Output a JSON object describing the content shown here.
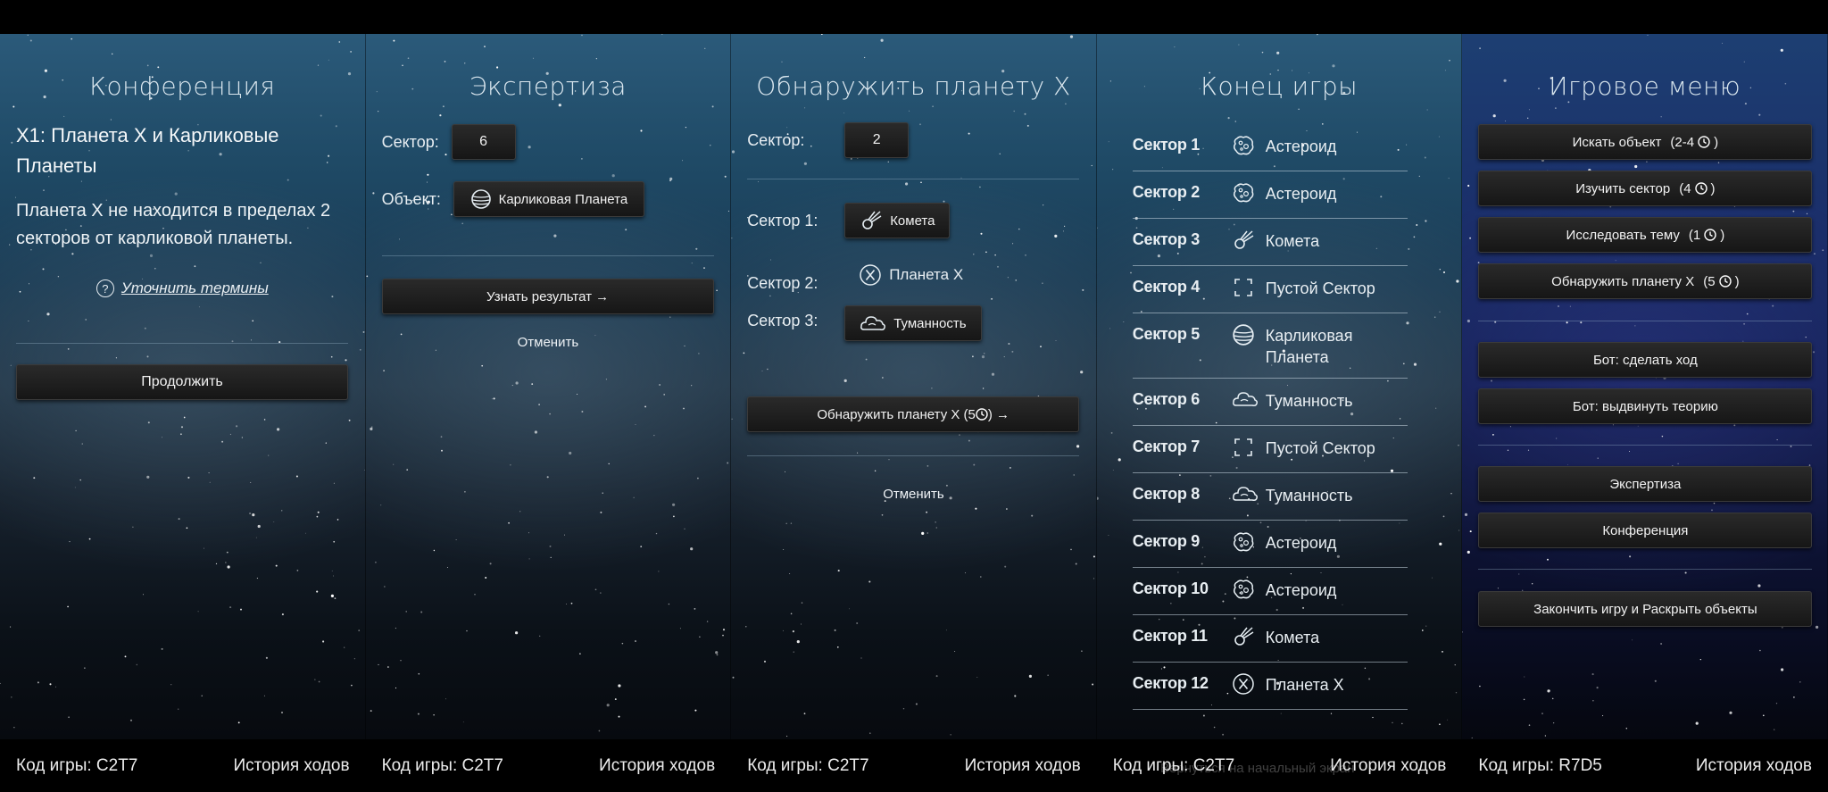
{
  "screen1": {
    "title": "Конференция",
    "heading": "X1: Планета X и Карликовые Планеты",
    "body": "Планета X не находится в пределах 2 секторов от карликовой планеты.",
    "terms_link": "Уточнить термины",
    "continue_button": "Продолжить"
  },
  "screen2": {
    "title": "Экспертиза",
    "sector_label": "Сектор:",
    "sector_value": "6",
    "object_label": "Объект:",
    "object_value": "Карликовая Планета",
    "object_icon": "dwarf-planet-icon",
    "result_button": "Узнать результат →",
    "cancel": "Отменить"
  },
  "screen3": {
    "title": "Обнаружить планету X",
    "sector_label": "Сектор:",
    "sector_value": "2",
    "sector1_label": "Сектор 1:",
    "sector1_value": "Комета",
    "sector2_label": "Сектор 2:",
    "sector2_value": "Планета X",
    "sector3_label": "Сектор 3:",
    "sector3_value": "Туманность",
    "detect_button_prefix": "Обнаружить планету X (5",
    "detect_button_suffix": ") →",
    "cancel": "Отменить"
  },
  "screen4": {
    "title": "Конец игры",
    "sectors": [
      {
        "name": "Сектор 1",
        "object": "Астероид",
        "icon": "asteroid-icon"
      },
      {
        "name": "Сектор 2",
        "object": "Астероид",
        "icon": "asteroid-icon"
      },
      {
        "name": "Сектор 3",
        "object": "Комета",
        "icon": "comet-icon"
      },
      {
        "name": "Сектор 4",
        "object": "Пустой Сектор",
        "icon": "empty-sector-icon"
      },
      {
        "name": "Сектор 5",
        "object": "Карликовая Планета",
        "icon": "dwarf-planet-icon"
      },
      {
        "name": "Сектор 6",
        "object": "Туманность",
        "icon": "nebula-icon"
      },
      {
        "name": "Сектор 7",
        "object": "Пустой Сектор",
        "icon": "empty-sector-icon"
      },
      {
        "name": "Сектор 8",
        "object": "Туманность",
        "icon": "nebula-icon"
      },
      {
        "name": "Сектор 9",
        "object": "Астероид",
        "icon": "asteroid-icon"
      },
      {
        "name": "Сектор 10",
        "object": "Астероид",
        "icon": "asteroid-icon"
      },
      {
        "name": "Сектор 11",
        "object": "Комета",
        "icon": "comet-icon"
      },
      {
        "name": "Сектор 12",
        "object": "Планета X",
        "icon": "planet-x-icon"
      }
    ],
    "ghost_text": "Вернуться на начальный экран"
  },
  "screen5": {
    "title": "Игровое меню",
    "search_object": {
      "label": "Искать объект",
      "cost_prefix": "(2-4",
      "cost_suffix": ")"
    },
    "survey_sector": {
      "label": "Изучить сектор",
      "cost_prefix": "(4",
      "cost_suffix": ")"
    },
    "research_topic": {
      "label": "Исследовать тему",
      "cost_prefix": "(1",
      "cost_suffix": ")"
    },
    "locate_planet": {
      "label": "Обнаружить планету X",
      "cost_prefix": "(5",
      "cost_suffix": ")"
    },
    "bot_move": "Бот: сделать ход",
    "bot_theory": "Бот: выдвинуть теорию",
    "peer_review": "Экспертиза",
    "conference": "Конференция",
    "end_game": "Закончить игру и Раскрыть объекты"
  },
  "footers": [
    {
      "code": "Код игры: C2T7",
      "history": "История ходов"
    },
    {
      "code": "Код игры: C2T7",
      "history": "История ходов"
    },
    {
      "code": "Код игры: C2T7",
      "history": "История ходов"
    },
    {
      "code": "Код игры: C2T7",
      "history": "История ходов"
    },
    {
      "code": "Код игры: R7D5",
      "history": "История ходов"
    }
  ]
}
